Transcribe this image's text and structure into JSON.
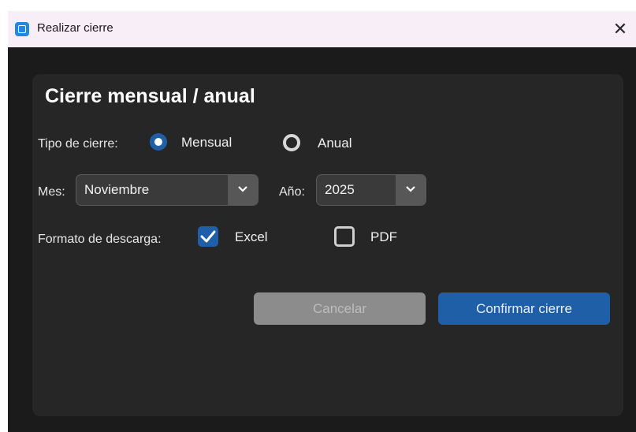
{
  "window": {
    "title": "Realizar cierre",
    "close_glyph": "✕",
    "icon": "app-window-icon"
  },
  "panel": {
    "heading": "Cierre mensual / anual",
    "closing_type": {
      "label": "Tipo de cierre:",
      "options": [
        {
          "label": "Mensual",
          "selected": true
        },
        {
          "label": "Anual",
          "selected": false
        }
      ]
    },
    "month": {
      "label": "Mes:",
      "value": "Noviembre"
    },
    "year": {
      "label": "Año:",
      "value": "2025"
    },
    "download_format": {
      "label": "Formato de descarga:",
      "options": [
        {
          "label": "Excel",
          "checked": true
        },
        {
          "label": "PDF",
          "checked": false
        }
      ]
    },
    "buttons": {
      "cancel": "Cancelar",
      "confirm": "Confirmar cierre"
    }
  },
  "colors": {
    "accent": "#1f5fa8",
    "panel": "#262626",
    "window": "#1b1b1b",
    "titlebar": "#f7eef7"
  }
}
